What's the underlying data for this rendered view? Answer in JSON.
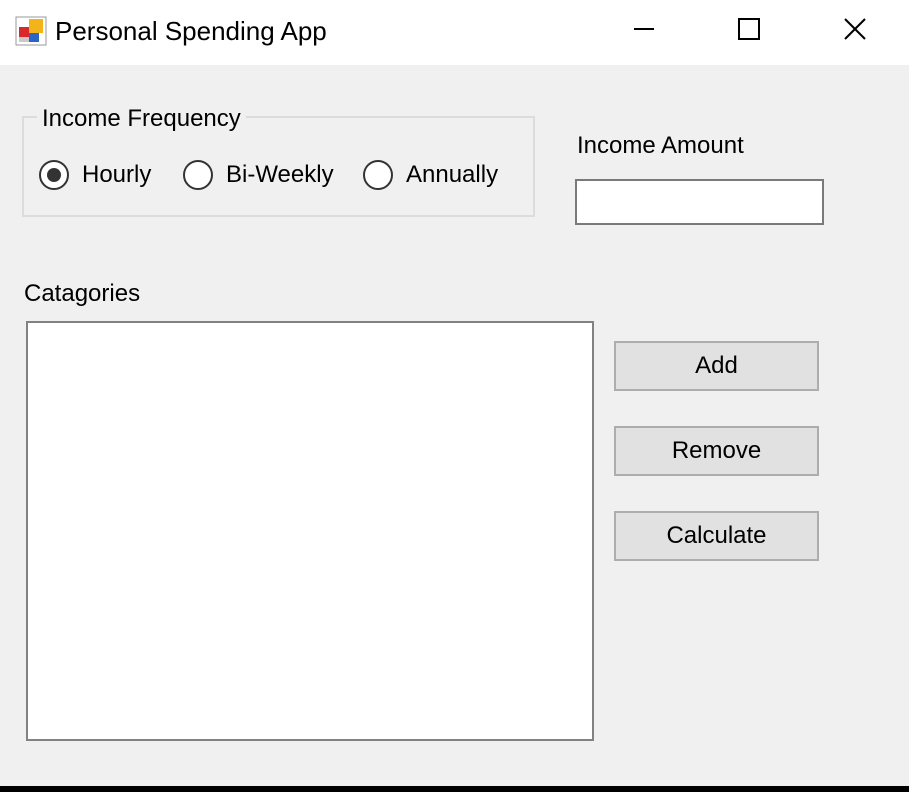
{
  "window": {
    "title": "Personal Spending App",
    "controls": [
      "minimize-icon",
      "maximize-icon",
      "close-icon"
    ]
  },
  "income_frequency": {
    "legend": "Income Frequency",
    "options": [
      {
        "label": "Hourly",
        "checked": true
      },
      {
        "label": "Bi-Weekly",
        "checked": false
      },
      {
        "label": "Annually",
        "checked": false
      }
    ]
  },
  "income_amount": {
    "label": "Income Amount",
    "value": ""
  },
  "categories": {
    "label": "Catagories",
    "items": []
  },
  "buttons": {
    "add": "Add",
    "remove": "Remove",
    "calculate": "Calculate"
  }
}
